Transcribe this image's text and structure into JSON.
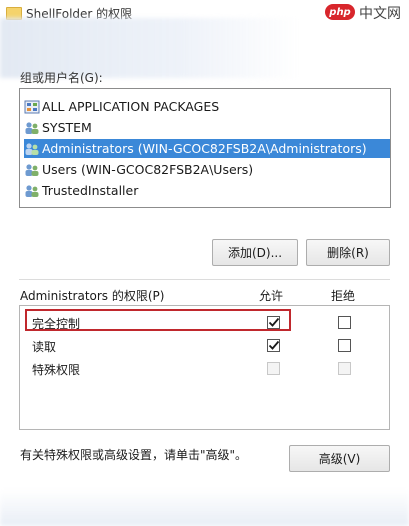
{
  "window": {
    "title": "ShellFolder 的权限"
  },
  "watermark": {
    "badge": "php",
    "text": "中文网"
  },
  "group_section": {
    "label": "组或用户名(G):"
  },
  "principals": [
    {
      "name": "ALL APPLICATION PACKAGES",
      "icon": "app-packages-icon",
      "selected": false
    },
    {
      "name": "SYSTEM",
      "icon": "user-group-icon",
      "selected": false
    },
    {
      "name": "Administrators (WIN-GCOC82FSB2A\\Administrators)",
      "icon": "user-group-icon",
      "selected": true
    },
    {
      "name": "Users (WIN-GCOC82FSB2A\\Users)",
      "icon": "user-group-icon",
      "selected": false
    },
    {
      "name": "TrustedInstaller",
      "icon": "user-group-icon",
      "selected": false
    }
  ],
  "buttons": {
    "add": "添加(D)...",
    "remove": "删除(R)",
    "advanced": "高级(V)"
  },
  "permissions": {
    "header": "Administrators 的权限(P)",
    "allow_label": "允许",
    "deny_label": "拒绝",
    "rows": [
      {
        "name": "完全控制",
        "allow": true,
        "deny": false,
        "disabled": false
      },
      {
        "name": "读取",
        "allow": true,
        "deny": false,
        "disabled": false
      },
      {
        "name": "特殊权限",
        "allow": false,
        "deny": false,
        "disabled": true
      }
    ]
  },
  "hint": "有关特殊权限或高级设置，请单击\"高级\"。",
  "colors": {
    "selection": "#3b88d8",
    "highlight": "#c0282d",
    "logo": "#d8262c"
  }
}
